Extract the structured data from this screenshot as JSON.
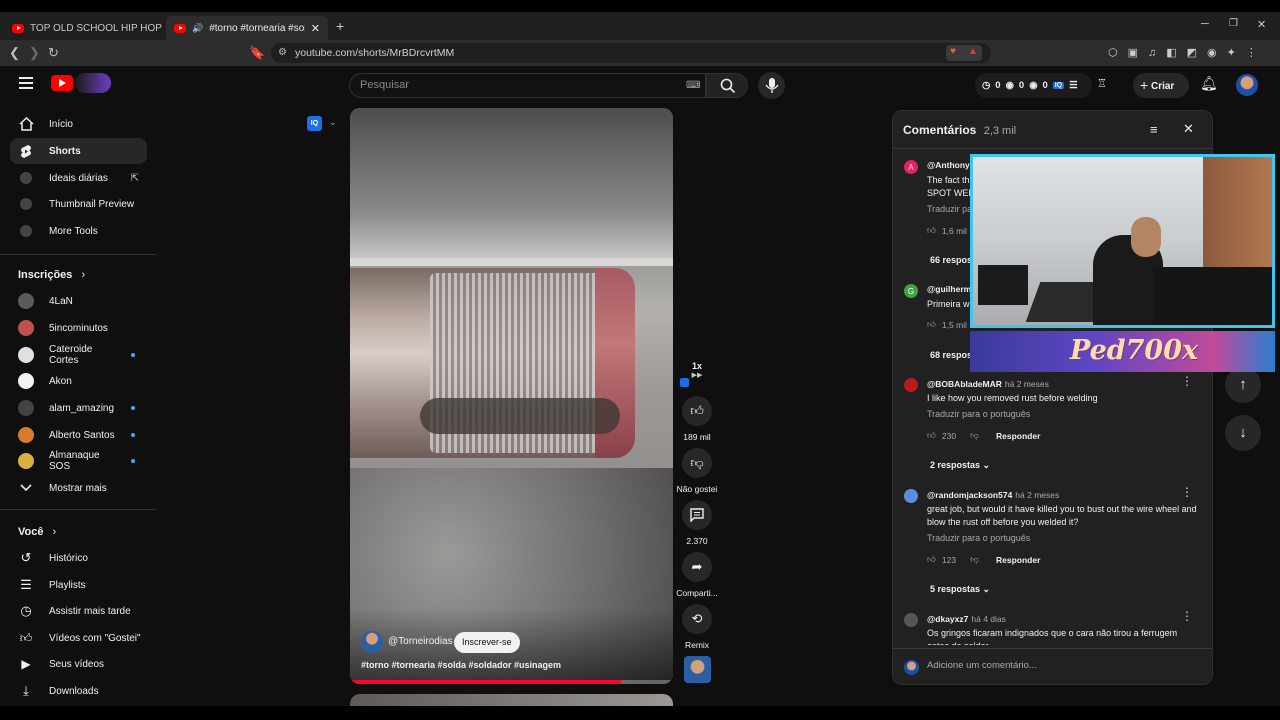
{
  "browser": {
    "tabs": [
      {
        "title": "TOP OLD SCHOOL HIP HOP 🔥 50 Ce",
        "active": false
      },
      {
        "title": "#torno #tornearia #solda #sc",
        "active": true
      }
    ],
    "url": "youtube.com/shorts/MrBDrcvrtMM",
    "new_tab": "+"
  },
  "header": {
    "search_placeholder": "Pesquisar",
    "stats": [
      "0",
      "0",
      "0"
    ],
    "create_label": "Criar"
  },
  "sidebar": {
    "main": [
      {
        "label": "Início",
        "icon": "home-icon"
      },
      {
        "label": "Shorts",
        "icon": "shorts-icon"
      },
      {
        "label": "Ideais diárias",
        "icon": "extension-icon"
      },
      {
        "label": "Thumbnail Preview",
        "icon": "extension-icon"
      },
      {
        "label": "More Tools",
        "icon": "extension-icon"
      }
    ],
    "subs_title": "Inscrições",
    "subs": [
      {
        "label": "4LaN",
        "color": "#5a5a5a",
        "dot": false
      },
      {
        "label": "5incominutos",
        "color": "#c0504d",
        "dot": false
      },
      {
        "label": "Cateroide Cortes",
        "color": "#e0e0e0",
        "dot": true
      },
      {
        "label": "Akon",
        "color": "#f2f2f2",
        "dot": false
      },
      {
        "label": "alam_amazing",
        "color": "#444",
        "dot": true
      },
      {
        "label": "Alberto Santos",
        "color": "#d67c2c",
        "dot": true
      },
      {
        "label": "Almanaque SOS",
        "color": "#d8b040",
        "dot": true
      }
    ],
    "show_more": "Mostrar mais",
    "you_title": "Você",
    "you": [
      {
        "label": "Histórico",
        "icon": "history-icon"
      },
      {
        "label": "Playlists",
        "icon": "playlists-icon"
      },
      {
        "label": "Assistir mais tarde",
        "icon": "clock-icon"
      },
      {
        "label": "Vídeos com \"Gostei\"",
        "icon": "thumb-up-icon"
      },
      {
        "label": "Seus vídeos",
        "icon": "video-icon"
      },
      {
        "label": "Downloads",
        "icon": "download-icon"
      }
    ]
  },
  "video": {
    "channel": "@Torneirodias",
    "subscribe": "Inscrever-se",
    "hashtags": "#torno #tornearia #solda #soldador #usinagem",
    "speed": "1x",
    "progress": 0.84
  },
  "actions": {
    "likes": "189 mil",
    "dislike": "Não gostei",
    "comments": "2.370",
    "share": "Comparti...",
    "remix": "Remix"
  },
  "comments": {
    "title": "Comentários",
    "count": "2,3 mil",
    "items": [
      {
        "user": "@AnthonyC",
        "ago": "",
        "text": "The fact th\nSPOT WEL",
        "translate": "Traduzir pa",
        "likes": "1,6 mil",
        "replies": "66 respos",
        "avatar": "A",
        "color": "#e91e63"
      },
      {
        "user": "@guilherm",
        "ago": "",
        "text": "Primeira w",
        "translate": "",
        "likes": "1,5 mil",
        "replies": "68 respos",
        "avatar": "G",
        "color": "#43a047"
      },
      {
        "user": "@BOBAbladeMAR",
        "ago": "há 2 meses",
        "text": "I like how you removed rust before welding",
        "translate": "Traduzir para o português",
        "likes": "230",
        "reply": "Responder",
        "replies": "2 respostas",
        "avatar": "",
        "color": "#b71c1c"
      },
      {
        "user": "@randomjackson574",
        "ago": "há 2 meses",
        "text": "great job, but would it have killed you to bust out the wire wheel and blow the rust off before you welded it?",
        "translate": "Traduzir para o português",
        "likes": "123",
        "reply": "Responder",
        "replies": "5 respostas",
        "avatar": "",
        "color": "#5c8de0"
      },
      {
        "user": "@dkayxz7",
        "ago": "há 4 dias",
        "text": "Os gringos ficaram indignados que o cara não tirou a ferrugem antes de soldar",
        "translate": "",
        "likes": "",
        "avatar": "",
        "color": "#555"
      }
    ],
    "add_placeholder": "Adicione um comentário..."
  },
  "overlay": {
    "banner_text": "Ped700x"
  }
}
